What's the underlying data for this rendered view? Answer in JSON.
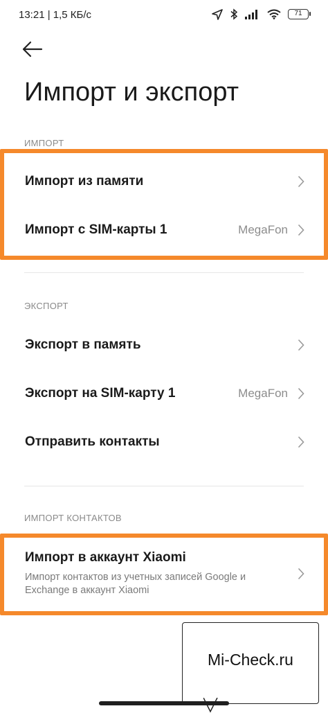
{
  "status": {
    "time_speed": "13:21 | 1,5 КБ/с",
    "battery": "71"
  },
  "page": {
    "title": "Импорт и экспорт"
  },
  "import_section": {
    "header": "ИМПОРТ",
    "items": [
      {
        "label": "Импорт из памяти",
        "value": ""
      },
      {
        "label": "Импорт с SIM-карты 1",
        "value": "MegaFon"
      }
    ]
  },
  "export_section": {
    "header": "ЭКСПОРТ",
    "items": [
      {
        "label": "Экспорт в память",
        "value": ""
      },
      {
        "label": "Экспорт на SIM-карту 1",
        "value": "MegaFon"
      },
      {
        "label": "Отправить контакты",
        "value": ""
      }
    ]
  },
  "contacts_section": {
    "header": "ИМПОРТ КОНТАКТОВ",
    "item": {
      "title": "Импорт в аккаунт Xiaomi",
      "subtitle": "Импорт контактов из учетных записей Google и Exchange в аккаунт Xiaomi"
    }
  },
  "watermark": {
    "text": "Mi-Check.ru"
  },
  "colors": {
    "highlight": "#f5892b",
    "secondary_text": "#8c8c8c"
  }
}
